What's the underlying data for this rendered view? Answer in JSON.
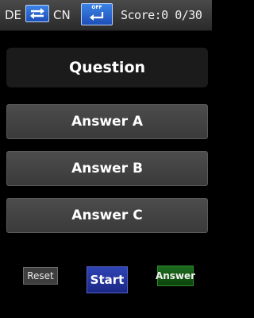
{
  "topbar": {
    "source_lang": "DE",
    "target_lang": "CN",
    "sound_state": "OFF",
    "score_text": "Score:0 0/30",
    "swap_icon": "swap-arrows-icon",
    "sound_icon": "return-arrow-icon"
  },
  "quiz": {
    "question": "Question",
    "answers": [
      "Answer A",
      "Answer B",
      "Answer C"
    ]
  },
  "controls": {
    "reset_label": "Reset",
    "start_label": "Start",
    "answer_label": "Answer"
  },
  "colors": {
    "background": "#000000",
    "topbar": "#3a3a3a",
    "button_blue": "#2a63d0",
    "start_blue": "#24339e",
    "answer_green": "#155a15"
  }
}
